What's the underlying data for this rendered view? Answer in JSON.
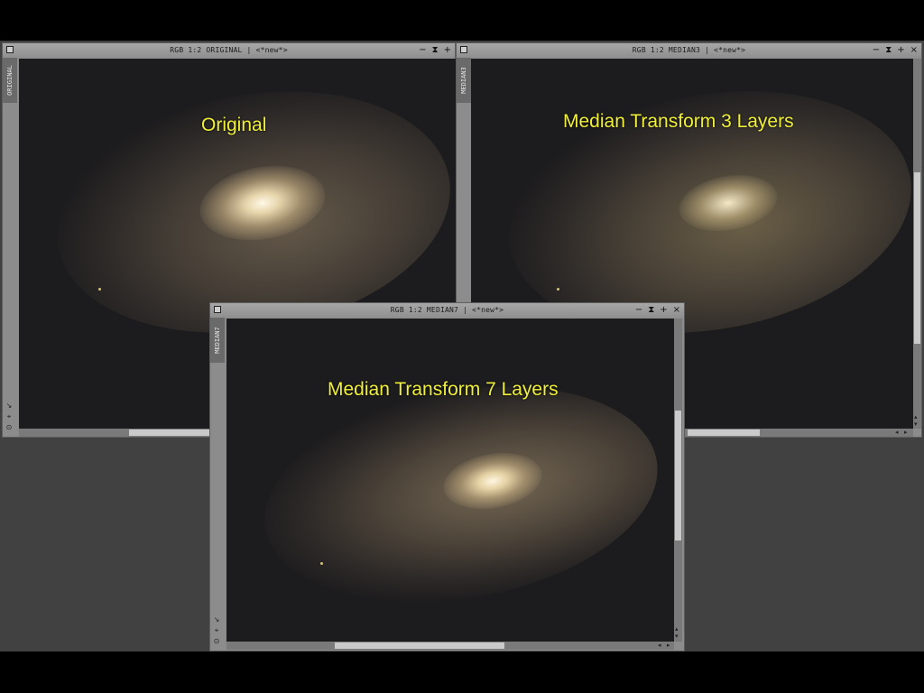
{
  "windows": {
    "original": {
      "title": "RGB 1:2 ORIGINAL | <*new*>",
      "tab": "ORIGINAL",
      "label": "Original"
    },
    "median3": {
      "title": "RGB 1:2 MEDIAN3 | <*new*>",
      "tab": "MEDIAN3",
      "label": "Median Transform 3 Layers"
    },
    "median7": {
      "title": "RGB 1:2 MEDIAN7 | <*new*>",
      "tab": "MEDIAN7",
      "label": "Median Transform 7 Layers"
    }
  },
  "controls": {
    "minimize": "−",
    "shade": "⧗",
    "maximize": "+",
    "close": "×"
  },
  "icons": [
    "window-icon",
    "minimize-icon",
    "shade-icon",
    "maximize-icon",
    "close-icon",
    "zoom-tool-icon",
    "pan-tool-icon",
    "readout-icon"
  ],
  "colors": {
    "label": "#f0f03a",
    "workspace": "#414141",
    "frame": "#8c8c8c"
  }
}
